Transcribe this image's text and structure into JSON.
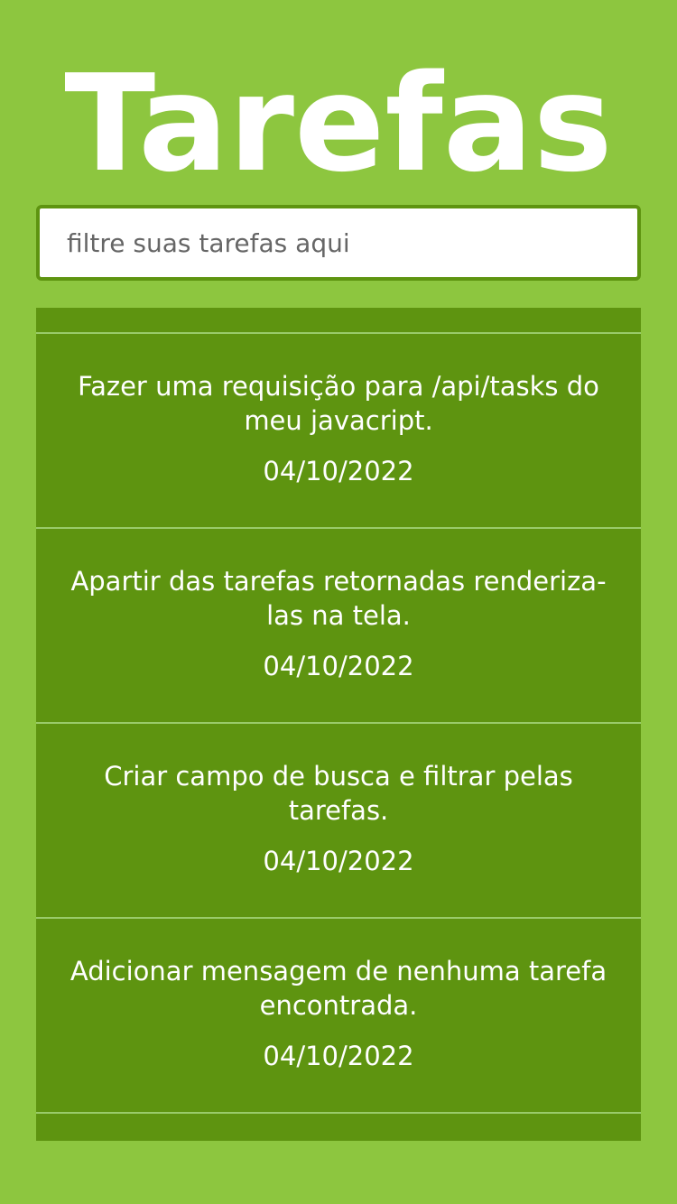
{
  "header": {
    "title": "Tarefas"
  },
  "search": {
    "placeholder": "filtre suas tarefas aqui",
    "value": ""
  },
  "tasks": [
    {
      "description": "Fazer uma requisição para /api/tasks do meu javacript.",
      "date": "04/10/2022"
    },
    {
      "description": "Apartir das tarefas retornadas renderiza-las na tela.",
      "date": "04/10/2022"
    },
    {
      "description": "Criar campo de busca e filtrar pelas tarefas.",
      "date": "04/10/2022"
    },
    {
      "description": "Adicionar mensagem de nenhuma tarefa encontrada.",
      "date": "04/10/2022"
    }
  ],
  "colors": {
    "background": "#8dc63f",
    "list_background": "#5e9410",
    "divider": "#9acb6a",
    "text": "#ffffff"
  }
}
